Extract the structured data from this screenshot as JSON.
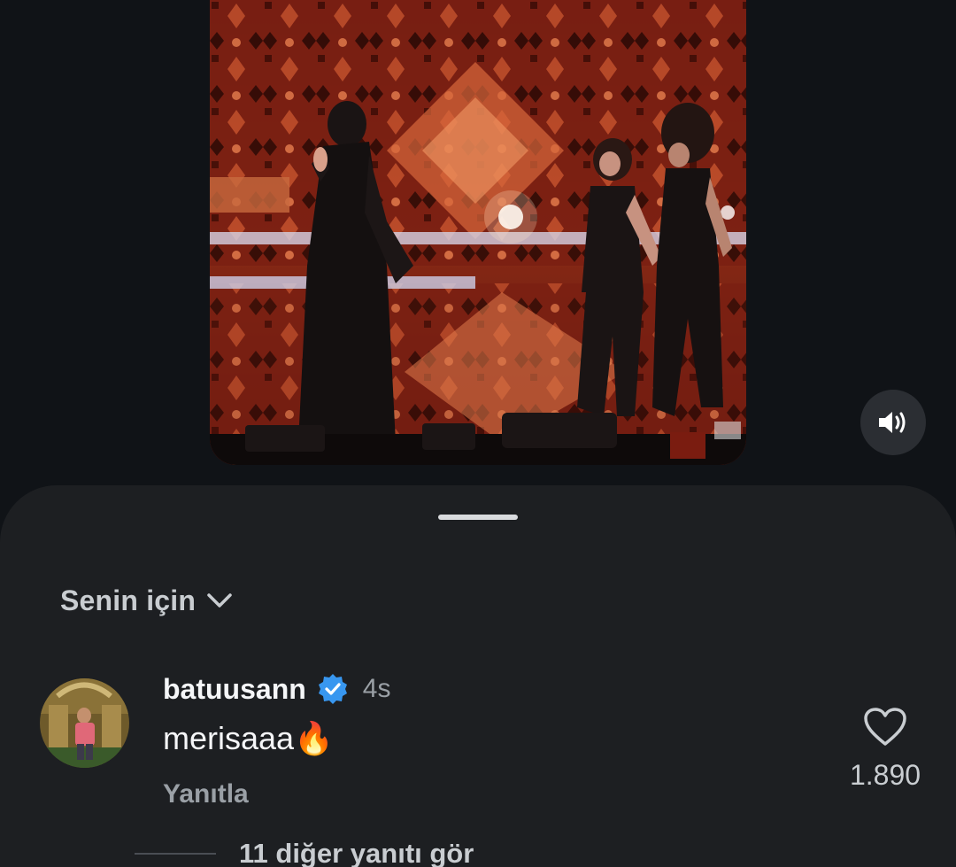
{
  "video": {
    "icon": "speaker-icon"
  },
  "sheet": {
    "sort_label": "Senin için",
    "sort_icon": "chevron-down-icon"
  },
  "comment": {
    "username": "batuusann",
    "verified_icon": "verified-badge-icon",
    "timestamp": "4s",
    "text": "merisaaa",
    "emoji": "🔥",
    "reply_label": "Yanıtla",
    "like_icon": "heart-icon",
    "like_count": "1.890"
  },
  "more_replies": {
    "label": "11 diğer yanıtı gör"
  },
  "colors": {
    "background": "#101317",
    "sheet": "#1d1f22",
    "verified": "#3897f0",
    "muted_text": "#9aa0a6"
  }
}
